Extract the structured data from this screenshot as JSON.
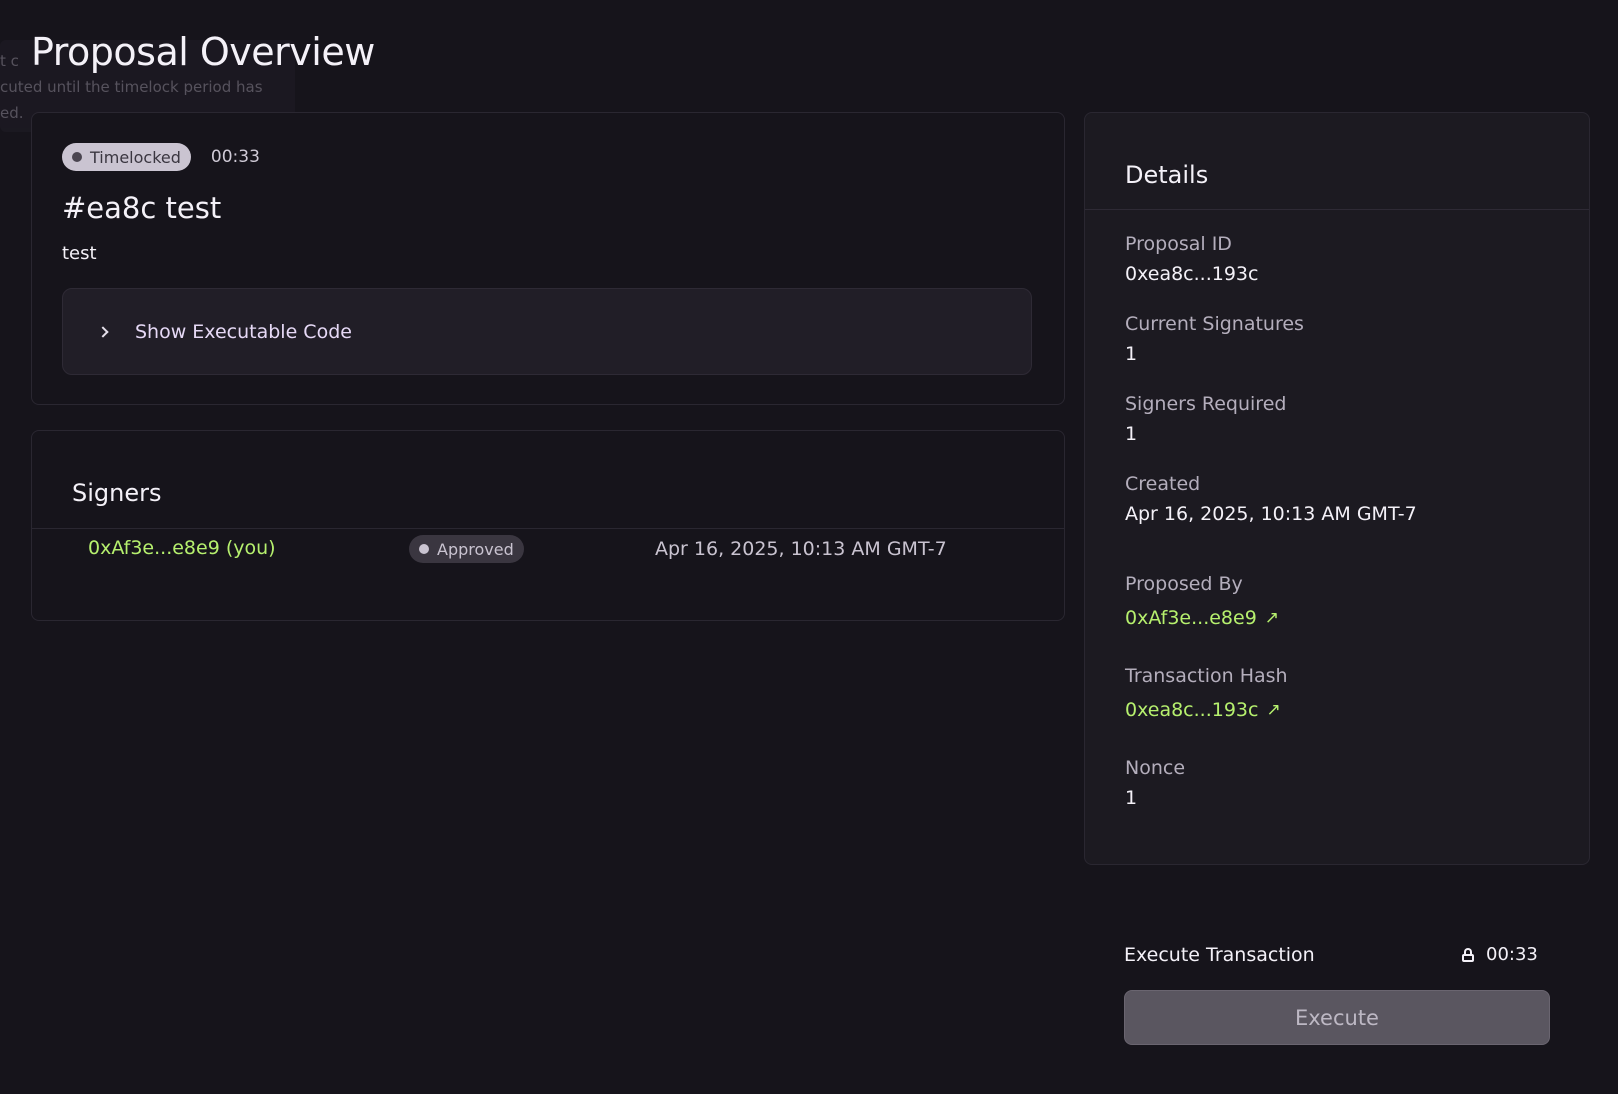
{
  "tooltip": {
    "lines": [
      "t c",
      "cuted until the timelock period has",
      "ed."
    ]
  },
  "page": {
    "title": "Proposal Overview"
  },
  "proposal": {
    "status": "Timelocked",
    "timer": "00:33",
    "title": "#ea8c test",
    "description": "test",
    "code_toggle_label": "Show Executable Code"
  },
  "signers": {
    "title": "Signers",
    "rows": [
      {
        "address": "0xAf3e...e8e9 (you)",
        "status": "Approved",
        "date": "Apr 16, 2025, 10:13 AM GMT-7"
      }
    ]
  },
  "details": {
    "title": "Details",
    "proposal_id_label": "Proposal ID",
    "proposal_id": "0xea8c...193c",
    "current_signatures_label": "Current Signatures",
    "current_signatures": "1",
    "signers_required_label": "Signers Required",
    "signers_required": "1",
    "created_label": "Created",
    "created": "Apr 16, 2025, 10:13 AM GMT-7",
    "proposed_by_label": "Proposed By",
    "proposed_by": "0xAf3e...e8e9",
    "tx_hash_label": "Transaction Hash",
    "tx_hash": "0xea8c...193c",
    "nonce_label": "Nonce",
    "nonce": "1",
    "external_link_icon": "↗"
  },
  "execute": {
    "label": "Execute Transaction",
    "timer": "00:33",
    "button_label": "Execute",
    "lock_icon": "lock-icon"
  },
  "colors": {
    "background": "#16141b",
    "accent_green": "#b6f06e",
    "panel": "#1c1a21",
    "muted_text": "#b4aebc"
  }
}
